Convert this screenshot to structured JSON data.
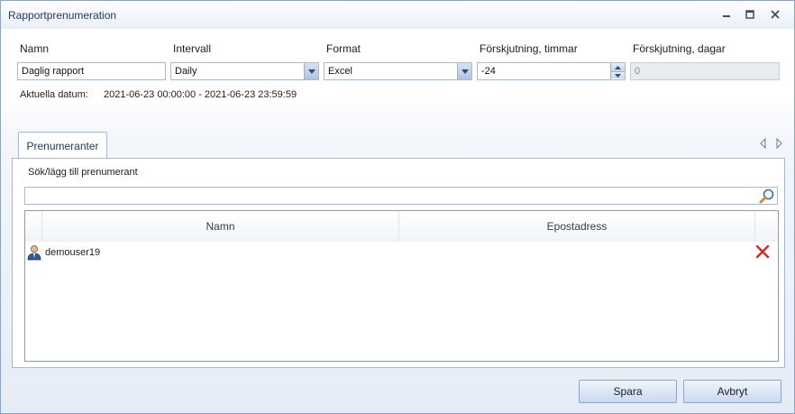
{
  "window": {
    "title": "Rapportprenumeration",
    "controls": {
      "minimize": "minimize-icon",
      "maximize": "maximize-icon",
      "close": "close-icon"
    }
  },
  "form": {
    "name": {
      "label": "Namn",
      "value": "Daglig rapport"
    },
    "interval": {
      "label": "Intervall",
      "value": "Daily"
    },
    "format": {
      "label": "Format",
      "value": "Excel"
    },
    "shift_hours": {
      "label": "Förskjutning, timmar",
      "value": "-24"
    },
    "shift_days": {
      "label": "Förskjutning, dagar",
      "value": "0"
    },
    "current_date_label": "Aktuella datum:",
    "current_date_value": "2021-06-23 00:00:00 - 2021-06-23 23:59:59"
  },
  "tabs": [
    {
      "label": "Prenumeranter",
      "active": true
    }
  ],
  "subscribers": {
    "search_label": "Sök/lägg till prenumerant",
    "search_value": "",
    "columns": [
      "Namn",
      "Epostadress"
    ],
    "rows": [
      {
        "name": "demouser19",
        "email": ""
      }
    ]
  },
  "buttons": {
    "save": "Spara",
    "cancel": "Avbryt"
  },
  "colors": {
    "accent": "#1f3b66",
    "delete": "#d8261b",
    "border": "#a6b8d6"
  }
}
